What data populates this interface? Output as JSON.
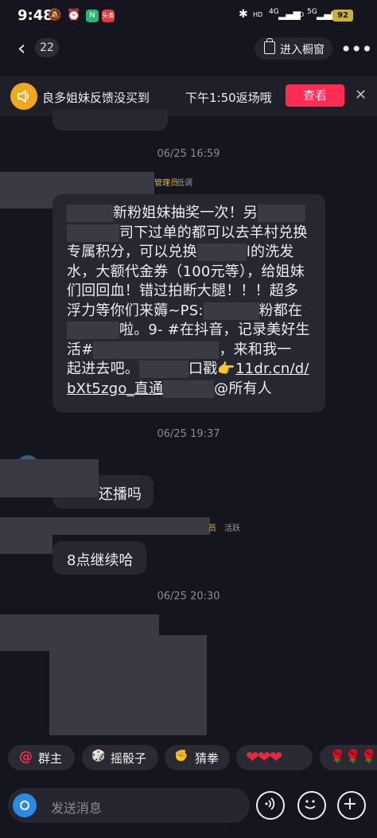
{
  "status_bar": {
    "time": "9:48",
    "app_badge_1": "N",
    "app_badge_2": "头条",
    "net_labels": [
      "HD",
      "4G",
      "HD",
      "5G"
    ],
    "battery": "92"
  },
  "header": {
    "back_glyph": "‹",
    "unread_count": "22",
    "window_label": "进入橱窗",
    "more_glyph": "•••"
  },
  "notice": {
    "text": "良多姐妹反馈没买到　　　下午1:50返场哦",
    "button": "查看",
    "close_glyph": "✕"
  },
  "timestamps": [
    "06/25 16:59",
    "06/25 19:37",
    "06/25 20:30"
  ],
  "messages": {
    "m1": {
      "role_tag": "管理员",
      "level_tag": "低调",
      "line1": "新粉姐妹抽奖一次！另",
      "line2": "司下过单的都可以去羊村兑换",
      "line3": "专属积分，可以兑换",
      "line3b": "l的洗发",
      "line4": "水，大额代金券（100元等），给姐妹",
      "line5": "们回回血！错过拍断大腿！！！超多",
      "line6": "浮力等你们来薅~PS:",
      "line6b": "粉都在",
      "line7": "啦。9- #在抖音，记录美好生",
      "line8a": "活#",
      "line8b": "，来和我一",
      "line9a": "起进去吧。",
      "line9b": "口戳👉",
      "line9c": "11dr.cn/d/",
      "line10a": "bXt5zgo_直通",
      "line10b": "@所有人"
    },
    "m2": {
      "text": "还播吗"
    },
    "m3": {
      "role_tag": "员",
      "level_tag": "活跃",
      "text": "8点继续哈"
    }
  },
  "quick_bar": {
    "items": [
      {
        "icon": "@",
        "label": "群主"
      },
      {
        "icon": "🎲",
        "label": "摇骰子"
      },
      {
        "icon": "✊",
        "label": "猜拳"
      },
      {
        "icon": "",
        "label": "❤❤❤"
      },
      {
        "icon": "",
        "label": "🌹🌹🌹"
      }
    ]
  },
  "input": {
    "placeholder": "发送消息",
    "icons": [
      "camera-icon",
      "voice-icon",
      "emoji-icon",
      "plus-icon"
    ]
  },
  "colors": {
    "background": "#15151f",
    "bubble": "#272731",
    "accent": "#fe2c55",
    "notice_icon": "#f2a81b",
    "camera": "#2a8ae6"
  }
}
